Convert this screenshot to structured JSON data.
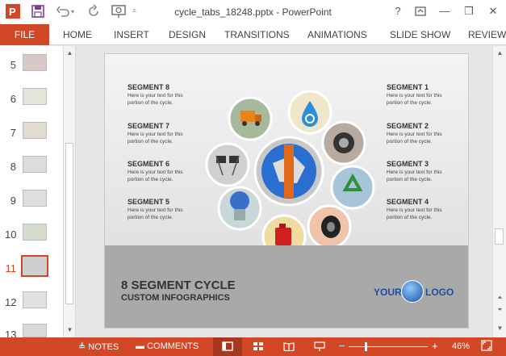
{
  "window": {
    "title": "cycle_tabs_18248.pptx - PowerPoint",
    "help": "?",
    "minimize": "—",
    "restore": "❐",
    "close": "✕",
    "ribbon_display": "⊡"
  },
  "quick_access": {
    "save_icon": "save-icon",
    "undo_icon": "undo-icon",
    "redo_icon": "redo-icon",
    "present_icon": "start-from-beginning-icon",
    "customize_icon": "customize-icon"
  },
  "ribbon": {
    "file": "FILE",
    "tabs": [
      "HOME",
      "INSERT",
      "DESIGN",
      "TRANSITIONS",
      "ANIMATIONS",
      "SLIDE SHOW",
      "REVIEW"
    ]
  },
  "thumbnails": [
    {
      "num": "5",
      "active": false
    },
    {
      "num": "6",
      "active": false
    },
    {
      "num": "7",
      "active": false
    },
    {
      "num": "8",
      "active": false
    },
    {
      "num": "9",
      "active": false
    },
    {
      "num": "10",
      "active": false
    },
    {
      "num": "11",
      "active": true
    },
    {
      "num": "12",
      "active": false
    },
    {
      "num": "13",
      "active": false
    }
  ],
  "slide": {
    "segments_left": [
      {
        "title": "SEGMENT 8",
        "desc": "Here is your text for this portion of the cycle."
      },
      {
        "title": "SEGMENT 7",
        "desc": "Here is your text for this portion of the cycle."
      },
      {
        "title": "SEGMENT 6",
        "desc": "Here is your text for this portion of the cycle."
      },
      {
        "title": "SEGMENT 5",
        "desc": "Here is your text for this portion of the cycle."
      }
    ],
    "segments_right": [
      {
        "title": "SEGMENT 1",
        "desc": "Here is your text for this portion of the cycle."
      },
      {
        "title": "SEGMENT 2",
        "desc": "Here is your text for this portion of the cycle."
      },
      {
        "title": "SEGMENT 3",
        "desc": "Here is your text for this portion of the cycle."
      },
      {
        "title": "SEGMENT 4",
        "desc": "Here is your text for this portion of the cycle."
      }
    ],
    "main_title": "8 SEGMENT CYCLE",
    "sub_title": "CUSTOM INFOGRAPHICS",
    "logo_left": "YOUR",
    "logo_right": "LOGO"
  },
  "statusbar": {
    "notes": "NOTES",
    "comments": "COMMENTS",
    "zoom": "46%",
    "zoom_minus": "−",
    "zoom_plus": "+"
  },
  "colors": {
    "accent": "#d24726",
    "logo": "#1a4fa0"
  }
}
